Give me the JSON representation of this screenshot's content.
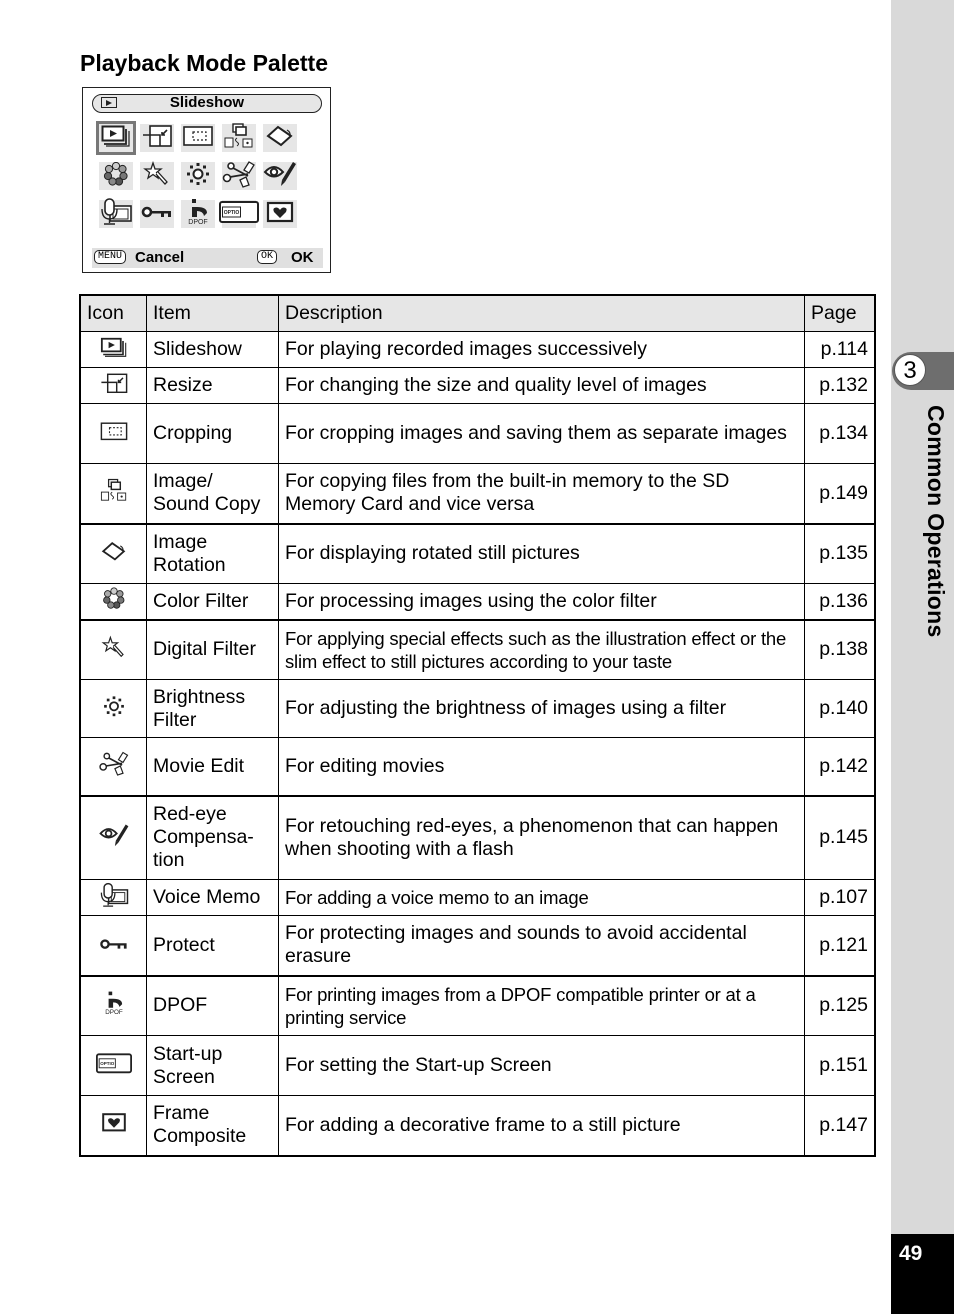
{
  "page": {
    "title": "Playback Mode Palette",
    "page_number": "49",
    "chapter": {
      "number": "3",
      "title": "Common Operations"
    }
  },
  "palette": {
    "header_label": "Slideshow",
    "header_icon": "playback-icon",
    "selected_index": 0,
    "rows": [
      [
        "slideshow-icon",
        "resize-icon",
        "cropping-icon",
        "image-sound-copy-icon",
        "image-rotation-icon"
      ],
      [
        "color-filter-icon",
        "digital-filter-icon",
        "brightness-filter-icon",
        "movie-edit-icon",
        "red-eye-icon"
      ],
      [
        "voice-memo-icon",
        "protect-icon",
        "dpof-icon",
        "startup-screen-icon",
        "frame-composite-icon"
      ]
    ],
    "dpof_label": "DPOF",
    "optio_label": "OPTIO",
    "footer": {
      "menu_key": "MENU",
      "cancel_label": "Cancel",
      "ok_key": "OK",
      "ok_label": "OK"
    }
  },
  "table": {
    "headers": {
      "icon": "Icon",
      "item": "Item",
      "description": "Description",
      "page": "Page"
    },
    "rows": [
      {
        "icon": "slideshow-icon",
        "item": "Slideshow",
        "description": "For playing recorded images successively",
        "page": "p.114"
      },
      {
        "icon": "resize-icon",
        "item": "Resize",
        "description": "For changing the size and quality level of images",
        "page": "p.132"
      },
      {
        "icon": "cropping-icon",
        "item": "Cropping",
        "description": "For cropping images and saving them as separate images",
        "page": "p.134"
      },
      {
        "icon": "image-sound-copy-icon",
        "item": "Image/ Sound Copy",
        "description": "For copying files from the built-in memory to the SD Memory Card and vice versa",
        "page": "p.149"
      },
      {
        "icon": "image-rotation-icon",
        "item": "Image Rotation",
        "description": "For displaying rotated still pictures",
        "page": "p.135"
      },
      {
        "icon": "color-filter-icon",
        "item": "Color Filter",
        "description": "For processing images using the color filter",
        "page": "p.136"
      },
      {
        "icon": "digital-filter-icon",
        "item": "Digital Filter",
        "description": "For applying special effects such as the illustration effect or the slim effect to still pictures according to your taste",
        "page": "p.138"
      },
      {
        "icon": "brightness-filter-icon",
        "item": "Brightness Filter",
        "description": "For adjusting the brightness of images using a filter",
        "page": "p.140"
      },
      {
        "icon": "movie-edit-icon",
        "item": "Movie Edit",
        "description": "For editing movies",
        "page": "p.142"
      },
      {
        "icon": "red-eye-icon",
        "item": "Red-eye Compensa-tion",
        "description": "For retouching red-eyes, a phenomenon that can happen when shooting with a flash",
        "page": "p.145"
      },
      {
        "icon": "voice-memo-icon",
        "item": "Voice Memo",
        "description": "For adding a voice memo to an image",
        "page": "p.107"
      },
      {
        "icon": "protect-icon",
        "item": "Protect",
        "description": "For protecting images and sounds to avoid accidental erasure",
        "page": "p.121"
      },
      {
        "icon": "dpof-icon",
        "item": "DPOF",
        "description": "For printing images from a DPOF compatible printer or at a printing service",
        "page": "p.125"
      },
      {
        "icon": "startup-screen-icon",
        "item": "Start-up Screen",
        "description": "For setting the Start-up Screen",
        "page": "p.151"
      },
      {
        "icon": "frame-composite-icon",
        "item": "Frame Composite",
        "description": "For adding a decorative frame to a still picture",
        "page": "p.147"
      }
    ]
  }
}
